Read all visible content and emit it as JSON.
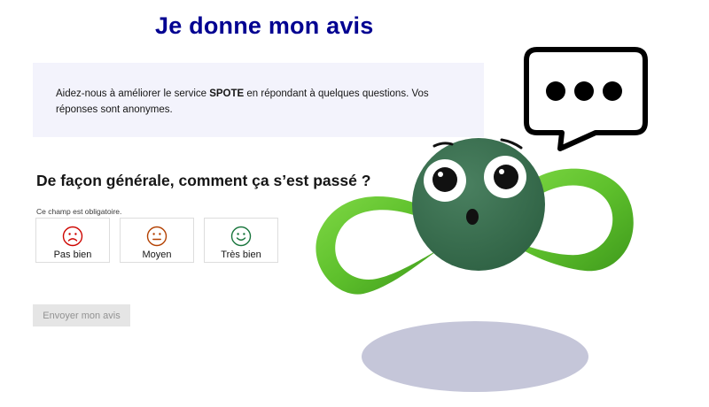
{
  "page": {
    "title": "Je donne mon avis"
  },
  "intro": {
    "text_before": "Aidez-nous à améliorer le service ",
    "service_name": "SPOTE",
    "text_after": " en répondant à quelques questions. Vos réponses sont anonymes."
  },
  "question": {
    "label": "De façon générale, comment ça s’est passé ?",
    "required_note": "Ce champ est obligatoire.",
    "options": [
      {
        "label": "Pas bien",
        "icon": "sad-face-icon",
        "color": "#ce0500"
      },
      {
        "label": "Moyen",
        "icon": "neutral-face-icon",
        "color": "#b34000"
      },
      {
        "label": "Très bien",
        "icon": "smile-face-icon",
        "color": "#18753c"
      }
    ]
  },
  "form": {
    "submit_label": "Envoyer mon avis"
  },
  "colors": {
    "title": "#000091",
    "intro_background": "#f3f3fc",
    "button_disabled_bg": "#e5e5e5",
    "button_disabled_text": "#929292",
    "mascot_body": "#3a6e4e",
    "mascot_ribbon": "#5ec02c",
    "shadow": "#c5c6d9"
  }
}
